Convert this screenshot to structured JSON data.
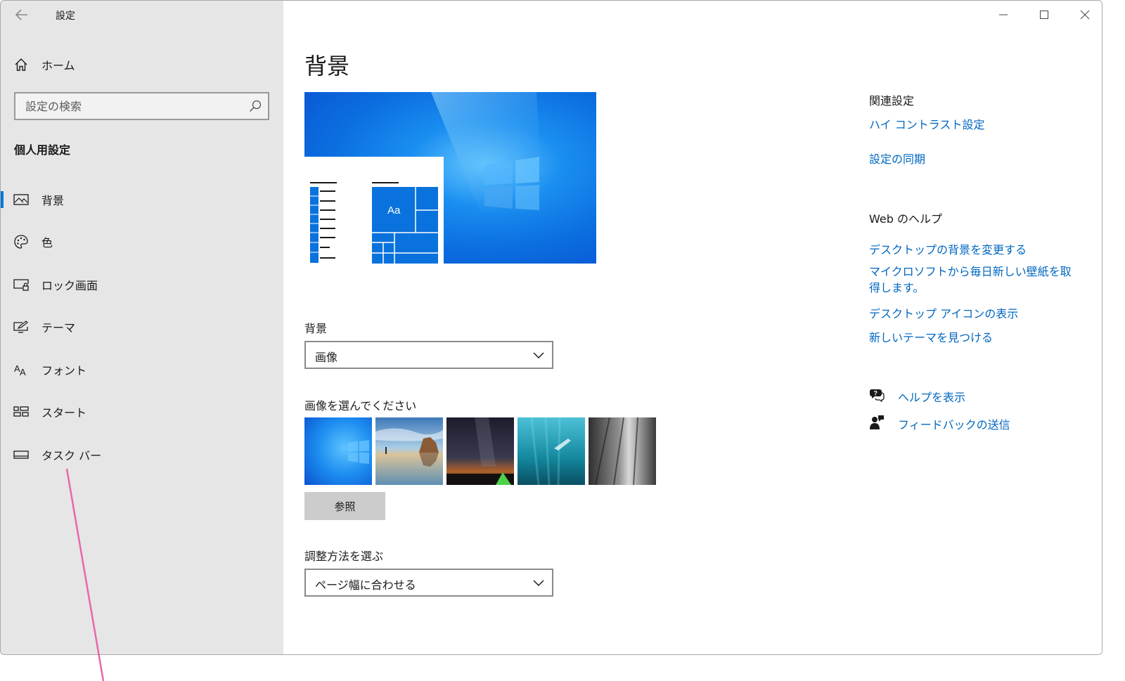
{
  "window": {
    "title": "設定"
  },
  "sidebar": {
    "home_label": "ホーム",
    "search_placeholder": "設定の検索",
    "section_title": "個人用設定",
    "items": [
      {
        "label": "背景",
        "icon": "picture-icon",
        "selected": true
      },
      {
        "label": "色",
        "icon": "palette-icon",
        "selected": false
      },
      {
        "label": "ロック画面",
        "icon": "lock-screen-icon",
        "selected": false
      },
      {
        "label": "テーマ",
        "icon": "theme-icon",
        "selected": false
      },
      {
        "label": "フォント",
        "icon": "font-icon",
        "selected": false
      },
      {
        "label": "スタート",
        "icon": "start-icon",
        "selected": false
      },
      {
        "label": "タスク バー",
        "icon": "taskbar-icon",
        "selected": false
      }
    ]
  },
  "main": {
    "page_title": "背景",
    "preview": {
      "tile_label": "Aa"
    },
    "background_label": "背景",
    "background_value": "画像",
    "choose_image_label": "画像を選んでください",
    "browse_label": "参照",
    "fit_label": "調整方法を選ぶ",
    "fit_value": "ページ幅に合わせる"
  },
  "related": {
    "heading": "関連設定",
    "links": [
      "ハイ コントラスト設定",
      "設定の同期"
    ]
  },
  "web_help": {
    "heading": "Web のヘルプ",
    "links": [
      "デスクトップの背景を変更する",
      "マイクロソフトから毎日新しい壁紙を取得します。",
      "デスクトップ アイコンの表示",
      "新しいテーマを見つける"
    ]
  },
  "help": {
    "show_help": "ヘルプを表示",
    "send_feedback": "フィードバックの送信"
  },
  "colors": {
    "accent": "#0078d7",
    "link": "#0067c0",
    "sidebar_bg": "#e6e6e6",
    "annotation": "#e868a8"
  }
}
